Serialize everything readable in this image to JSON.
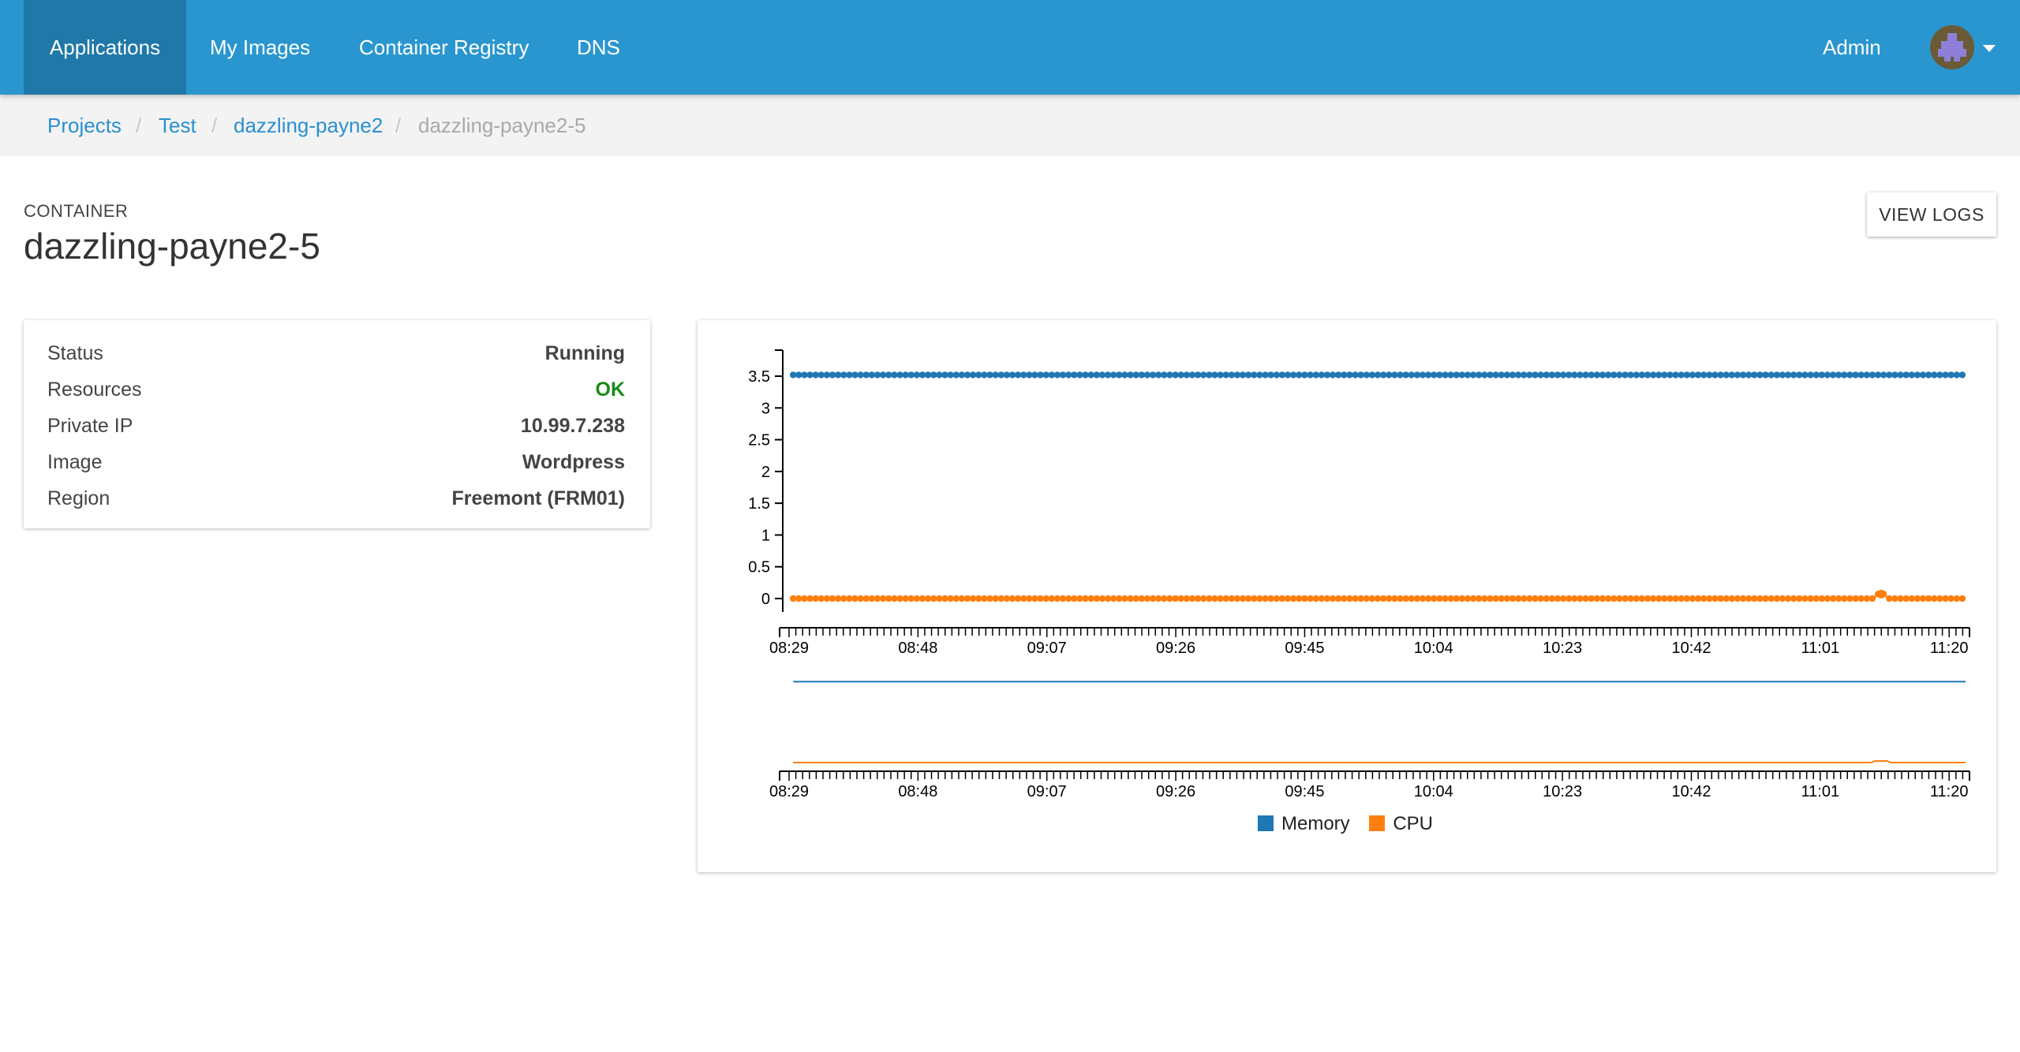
{
  "nav": {
    "items": [
      {
        "label": "Applications",
        "active": true
      },
      {
        "label": "My Images",
        "active": false
      },
      {
        "label": "Container Registry",
        "active": false
      },
      {
        "label": "DNS",
        "active": false
      }
    ],
    "admin_label": "Admin",
    "avatar_icon": "user-avatar-icon"
  },
  "breadcrumb": [
    "Projects",
    "Test",
    "dazzling-payne2",
    "dazzling-payne2-5"
  ],
  "header": {
    "label": "CONTAINER",
    "title": "dazzling-payne2-5",
    "view_logs": "VIEW LOGS"
  },
  "info": {
    "rows": [
      {
        "label": "Status",
        "value": "Running"
      },
      {
        "label": "Resources",
        "value": "OK"
      },
      {
        "label": "Private IP",
        "value": "10.99.7.238"
      },
      {
        "label": "Image",
        "value": "Wordpress"
      },
      {
        "label": "Region",
        "value": "Freemont (FRM01)"
      }
    ],
    "ok_color": "#1a8a1a"
  },
  "chart_data": {
    "type": "line",
    "y_ticks": [
      "0",
      "0.5",
      "1",
      "1.5",
      "2",
      "2.5",
      "3",
      "3.5"
    ],
    "ylim": [
      0,
      3.5
    ],
    "x_ticks": [
      "08:29",
      "08:48",
      "09:07",
      "09:26",
      "09:45",
      "10:04",
      "10:23",
      "10:42",
      "11:01",
      "11:20"
    ],
    "x_range": [
      "08:29",
      "11:23"
    ],
    "series": [
      {
        "name": "Memory",
        "color": "#1f77b4",
        "value": 3.52
      },
      {
        "name": "CPU",
        "color": "#ff7f0e",
        "value": 0.0,
        "spike": {
          "time": "11:10",
          "value": 0.07
        }
      }
    ],
    "brush_context": true,
    "legend_position": "bottom"
  }
}
